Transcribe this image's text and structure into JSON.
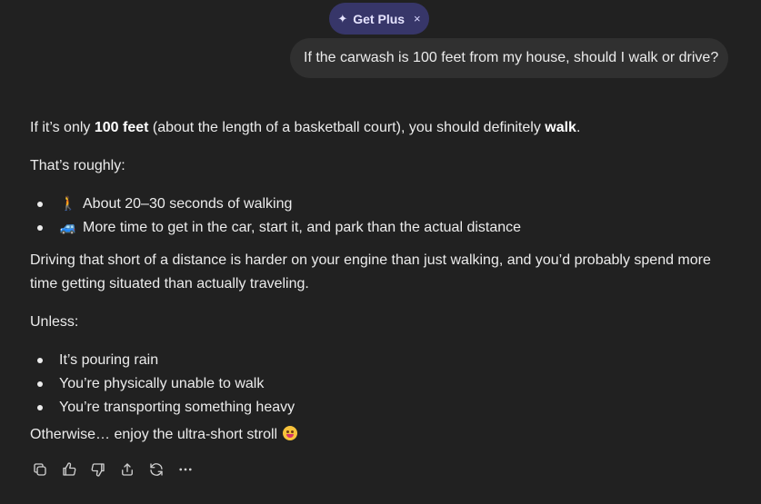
{
  "header": {
    "get_plus": {
      "icon": "sparkle-icon",
      "label": "Get Plus",
      "close_icon": "close-icon",
      "close_glyph": "×",
      "accent": "#373669"
    }
  },
  "conversation": {
    "user_message": "If the carwash is 100 feet from my house, should I walk or drive?",
    "assistant": {
      "intro": {
        "before": "If it’s only ",
        "bold1": "100 feet",
        "middle": " (about the length of a basketball court), you should definitely ",
        "bold2": "walk",
        "after": "."
      },
      "roughly": "That’s roughly:",
      "bullets_a": [
        {
          "emoji": "🚶",
          "icon": "person-walking-icon",
          "text": "About 20–30 seconds of walking"
        },
        {
          "emoji": "🚙",
          "icon": "car-icon",
          "text": "More time to get in the car, start it, and park than the actual distance"
        }
      ],
      "driving_paragraph": "Driving that short of a distance is harder on your engine than just walking, and you’d probably spend more time getting situated than actually traveling.",
      "unless": "Unless:",
      "bullets_b": [
        "It’s pouring rain",
        "You’re physically unable to walk",
        "You’re transporting something heavy"
      ],
      "closing": "Otherwise… enjoy the ultra-short stroll",
      "closing_icon": "grinning-face-icon"
    }
  },
  "actions": [
    {
      "icon": "copy-icon"
    },
    {
      "icon": "thumbs-up-icon"
    },
    {
      "icon": "thumbs-down-icon"
    },
    {
      "icon": "share-icon"
    },
    {
      "icon": "regenerate-icon"
    },
    {
      "icon": "more-icon"
    }
  ],
  "colors": {
    "background": "#212121",
    "user_bubble": "#303030",
    "text": "#ececec"
  }
}
